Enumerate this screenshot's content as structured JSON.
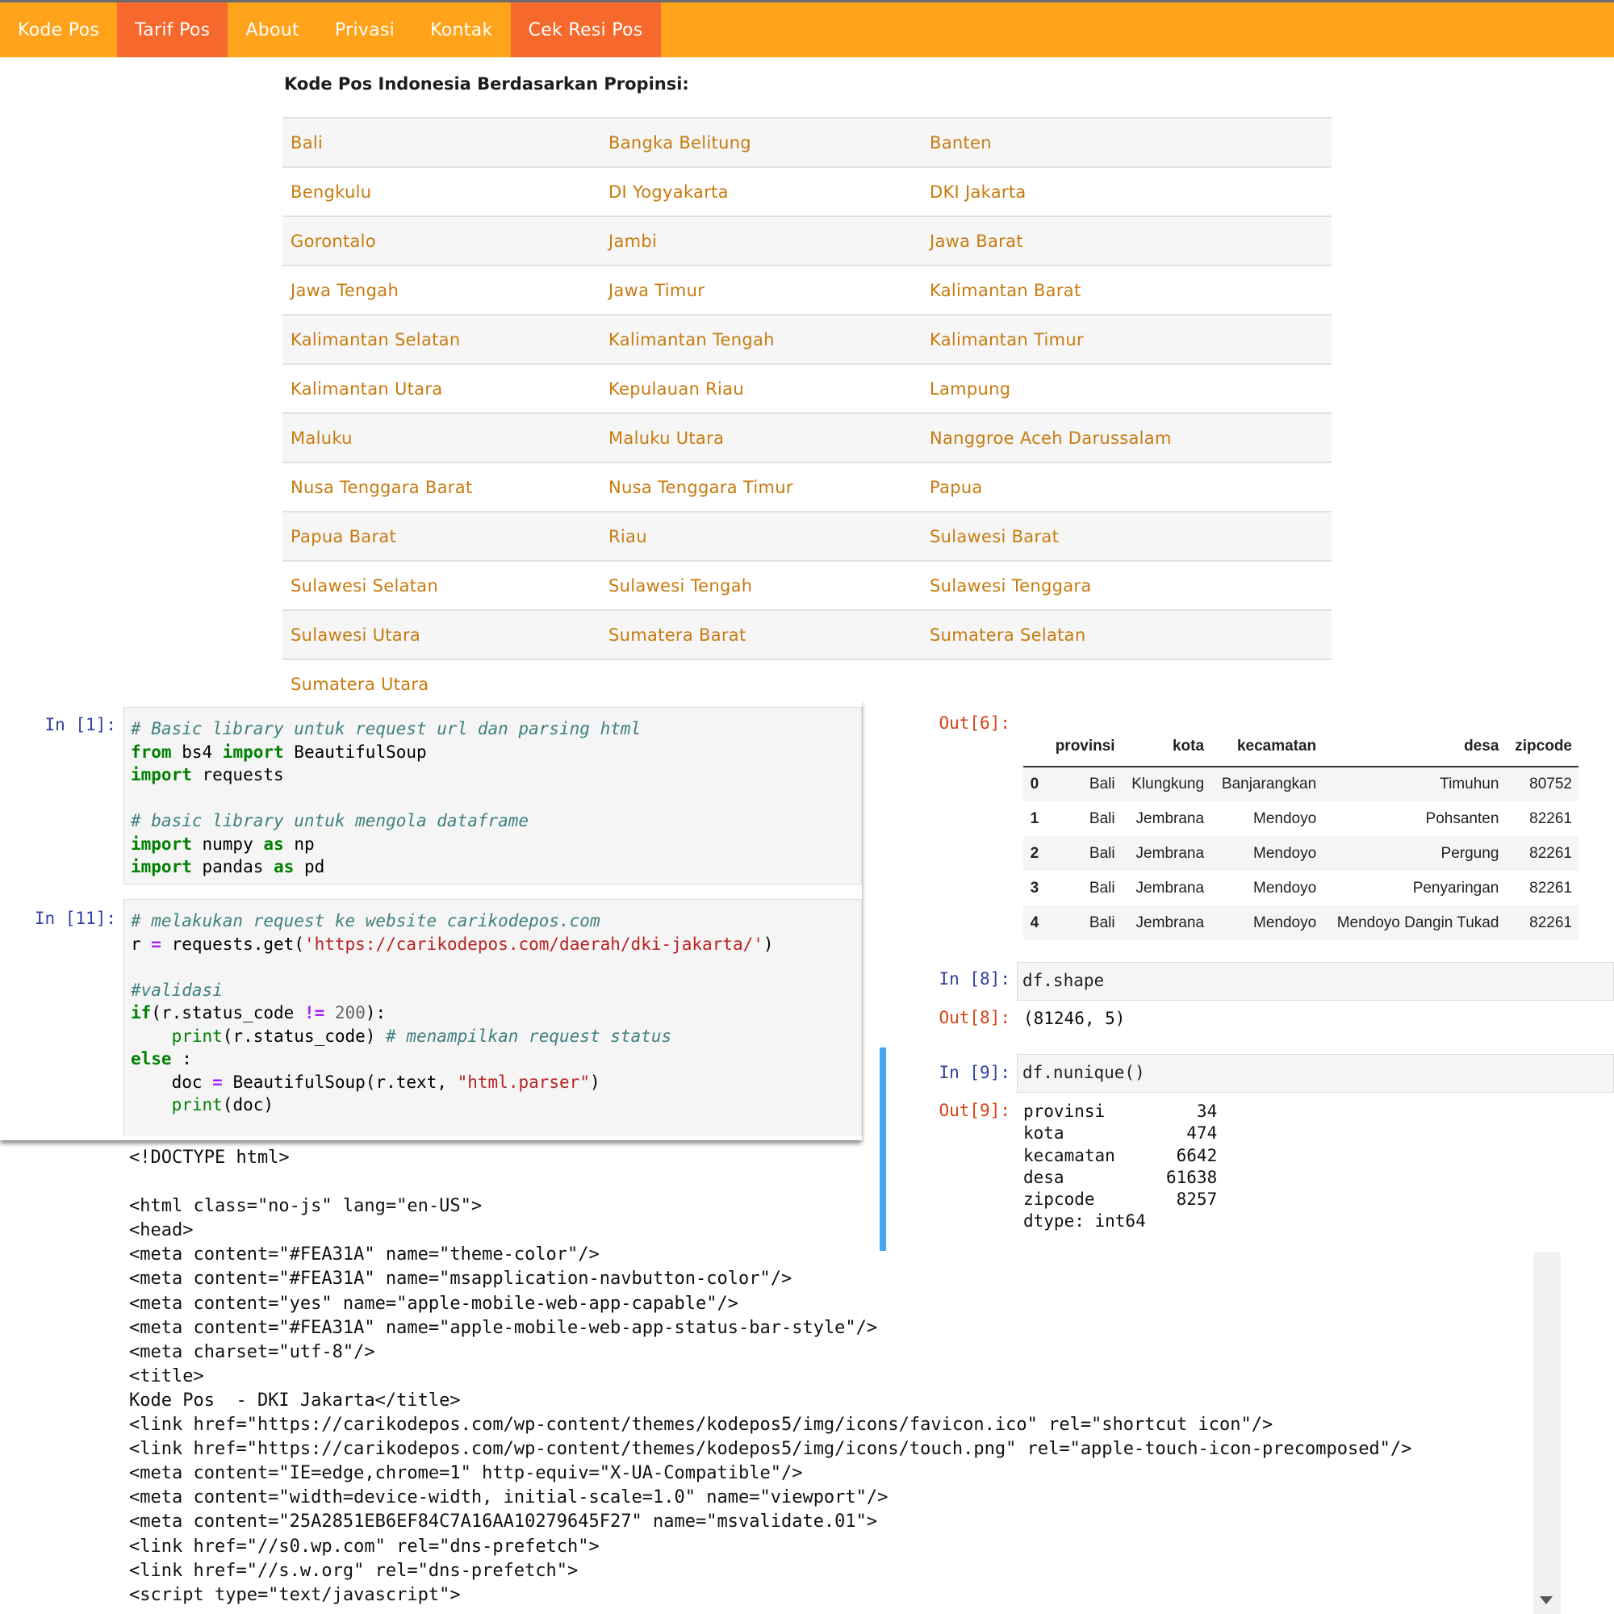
{
  "navbar": {
    "items": [
      {
        "label": "Kode Pos",
        "active": false
      },
      {
        "label": "Tarif Pos",
        "active": true
      },
      {
        "label": "About",
        "active": false
      },
      {
        "label": "Privasi",
        "active": false
      },
      {
        "label": "Kontak",
        "active": false
      },
      {
        "label": "Cek Resi Pos",
        "active": true
      }
    ],
    "color": "#FEA31A",
    "active_color": "#F7682C"
  },
  "provinces": {
    "title": "Kode Pos Indonesia Berdasarkan Propinsi:",
    "rows": [
      [
        "Bali",
        "Bangka Belitung",
        "Banten"
      ],
      [
        "Bengkulu",
        "DI Yogyakarta",
        "DKI Jakarta"
      ],
      [
        "Gorontalo",
        "Jambi",
        "Jawa Barat"
      ],
      [
        "Jawa Tengah",
        "Jawa Timur",
        "Kalimantan Barat"
      ],
      [
        "Kalimantan Selatan",
        "Kalimantan Tengah",
        "Kalimantan Timur"
      ],
      [
        "Kalimantan Utara",
        "Kepulauan Riau",
        "Lampung"
      ],
      [
        "Maluku",
        "Maluku Utara",
        "Nanggroe Aceh Darussalam"
      ],
      [
        "Nusa Tenggara Barat",
        "Nusa Tenggara Timur",
        "Papua"
      ],
      [
        "Papua Barat",
        "Riau",
        "Sulawesi Barat"
      ],
      [
        "Sulawesi Selatan",
        "Sulawesi Tengah",
        "Sulawesi Tenggara"
      ],
      [
        "Sulawesi Utara",
        "Sumatera Barat",
        "Sumatera Selatan"
      ],
      [
        "Sumatera Utara",
        "",
        ""
      ]
    ],
    "link_color": "#C87A0E"
  },
  "notebook_left": {
    "cell1": {
      "prompt": "In [1]:",
      "lines": [
        [
          {
            "t": "# Basic library untuk request url dan parsing html",
            "c": "cm"
          }
        ],
        [
          {
            "t": "from",
            "c": "kw"
          },
          {
            "t": " bs4 ",
            "c": ""
          },
          {
            "t": "import",
            "c": "kw"
          },
          {
            "t": " BeautifulSoup",
            "c": ""
          }
        ],
        [
          {
            "t": "import",
            "c": "kw"
          },
          {
            "t": " requests",
            "c": ""
          }
        ],
        [
          {
            "t": "",
            "c": ""
          }
        ],
        [
          {
            "t": "# basic library untuk mengola dataframe",
            "c": "cm"
          }
        ],
        [
          {
            "t": "import",
            "c": "kw"
          },
          {
            "t": " numpy ",
            "c": ""
          },
          {
            "t": "as",
            "c": "kw"
          },
          {
            "t": " np",
            "c": ""
          }
        ],
        [
          {
            "t": "import",
            "c": "kw"
          },
          {
            "t": " pandas ",
            "c": ""
          },
          {
            "t": "as",
            "c": "kw"
          },
          {
            "t": " pd",
            "c": ""
          }
        ]
      ]
    },
    "cell2": {
      "prompt": "In [11]:",
      "lines": [
        [
          {
            "t": "# melakukan request ke website carikodepos.com",
            "c": "cm"
          }
        ],
        [
          {
            "t": "r ",
            "c": ""
          },
          {
            "t": "=",
            "c": "op"
          },
          {
            "t": " requests.get(",
            "c": ""
          },
          {
            "t": "'https://carikodepos.com/daerah/dki-jakarta/'",
            "c": "str"
          },
          {
            "t": ")",
            "c": ""
          }
        ],
        [
          {
            "t": "",
            "c": ""
          }
        ],
        [
          {
            "t": "#validasi",
            "c": "cm"
          }
        ],
        [
          {
            "t": "if",
            "c": "kw"
          },
          {
            "t": "(r.status_code ",
            "c": ""
          },
          {
            "t": "!=",
            "c": "op"
          },
          {
            "t": " ",
            "c": ""
          },
          {
            "t": "200",
            "c": "num"
          },
          {
            "t": "):",
            "c": ""
          }
        ],
        [
          {
            "t": "    ",
            "c": ""
          },
          {
            "t": "print",
            "c": "fn"
          },
          {
            "t": "(r.status_code) ",
            "c": ""
          },
          {
            "t": "# menampilkan request status",
            "c": "cm"
          }
        ],
        [
          {
            "t": "else",
            "c": "kw"
          },
          {
            "t": " :",
            "c": ""
          }
        ],
        [
          {
            "t": "    doc ",
            "c": ""
          },
          {
            "t": "=",
            "c": "op"
          },
          {
            "t": " BeautifulSoup(r.text, ",
            "c": ""
          },
          {
            "t": "\"html.parser\"",
            "c": "str"
          },
          {
            "t": ")",
            "c": ""
          }
        ],
        [
          {
            "t": "    ",
            "c": ""
          },
          {
            "t": "print",
            "c": "fn"
          },
          {
            "t": "(doc)",
            "c": ""
          }
        ]
      ]
    }
  },
  "raw_output": {
    "lines": [
      "<!DOCTYPE html>",
      "",
      "<html class=\"no-js\" lang=\"en-US\">",
      "<head>",
      "<meta content=\"#FEA31A\" name=\"theme-color\"/>",
      "<meta content=\"#FEA31A\" name=\"msapplication-navbutton-color\"/>",
      "<meta content=\"yes\" name=\"apple-mobile-web-app-capable\"/>",
      "<meta content=\"#FEA31A\" name=\"apple-mobile-web-app-status-bar-style\"/>",
      "<meta charset=\"utf-8\"/>",
      "<title>",
      "Kode Pos  - DKI Jakarta</title>",
      "<link href=\"https://carikodepos.com/wp-content/themes/kodepos5/img/icons/favicon.ico\" rel=\"shortcut icon\"/>",
      "<link href=\"https://carikodepos.com/wp-content/themes/kodepos5/img/icons/touch.png\" rel=\"apple-touch-icon-precomposed\"/>",
      "<meta content=\"IE=edge,chrome=1\" http-equiv=\"X-UA-Compatible\"/>",
      "<meta content=\"width=device-width, initial-scale=1.0\" name=\"viewport\"/>",
      "<meta content=\"25A2851EB6EF84C7A16AA10279645F27\" name=\"msvalidate.01\">",
      "<link href=\"//s0.wp.com\" rel=\"dns-prefetch\">",
      "<link href=\"//s.w.org\" rel=\"dns-prefetch\">",
      "<script type=\"text/javascript\">"
    ]
  },
  "notebook_right": {
    "out6": {
      "prompt": "Out[6]:",
      "columns": [
        "",
        "provinsi",
        "kota",
        "kecamatan",
        "desa",
        "zipcode"
      ],
      "rows": [
        [
          "0",
          "Bali",
          "Klungkung",
          "Banjarangkan",
          "Timuhun",
          "80752"
        ],
        [
          "1",
          "Bali",
          "Jembrana",
          "Mendoyo",
          "Pohsanten",
          "82261"
        ],
        [
          "2",
          "Bali",
          "Jembrana",
          "Mendoyo",
          "Pergung",
          "82261"
        ],
        [
          "3",
          "Bali",
          "Jembrana",
          "Mendoyo",
          "Penyaringan",
          "82261"
        ],
        [
          "4",
          "Bali",
          "Jembrana",
          "Mendoyo",
          "Mendoyo Dangin Tukad",
          "82261"
        ]
      ]
    },
    "in8": {
      "prompt": "In [8]:",
      "code": "df.shape"
    },
    "out8": {
      "prompt": "Out[8]:",
      "text": "(81246, 5)"
    },
    "in9": {
      "prompt": "In [9]:",
      "code": "df.nunique()"
    },
    "out9": {
      "prompt": "Out[9]:",
      "lines": [
        "provinsi         34",
        "kota            474",
        "kecamatan      6642",
        "desa          61638",
        "zipcode        8257",
        "dtype: int64"
      ]
    }
  }
}
